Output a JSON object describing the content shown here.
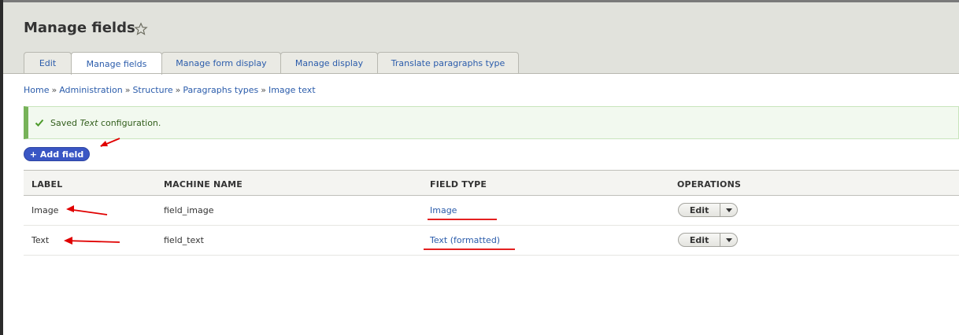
{
  "page": {
    "title": "Manage fields",
    "favorite_icon": "star-icon"
  },
  "tabs": [
    {
      "label": "Edit",
      "active": false
    },
    {
      "label": "Manage fields",
      "active": true
    },
    {
      "label": "Manage form display",
      "active": false
    },
    {
      "label": "Manage display",
      "active": false
    },
    {
      "label": "Translate paragraphs type",
      "active": false
    }
  ],
  "breadcrumb": {
    "items": [
      "Home",
      "Administration",
      "Structure",
      "Paragraphs types",
      "Image text"
    ],
    "separator": "»"
  },
  "message": {
    "prefix": "Saved",
    "emphasis": "Text",
    "suffix": "configuration.",
    "icon": "check-icon",
    "color": "#77b259"
  },
  "add_field": {
    "label": "+ Add field",
    "color": "#3a56c4"
  },
  "table": {
    "headers": [
      "LABEL",
      "MACHINE NAME",
      "FIELD TYPE",
      "OPERATIONS"
    ],
    "rows": [
      {
        "label": "Image",
        "machine_name": "field_image",
        "field_type": "Image",
        "operation": "Edit"
      },
      {
        "label": "Text",
        "machine_name": "field_text",
        "field_type": "Text (formatted)",
        "operation": "Edit"
      }
    ]
  },
  "annotations": {
    "arrow_color": "#e00000"
  }
}
